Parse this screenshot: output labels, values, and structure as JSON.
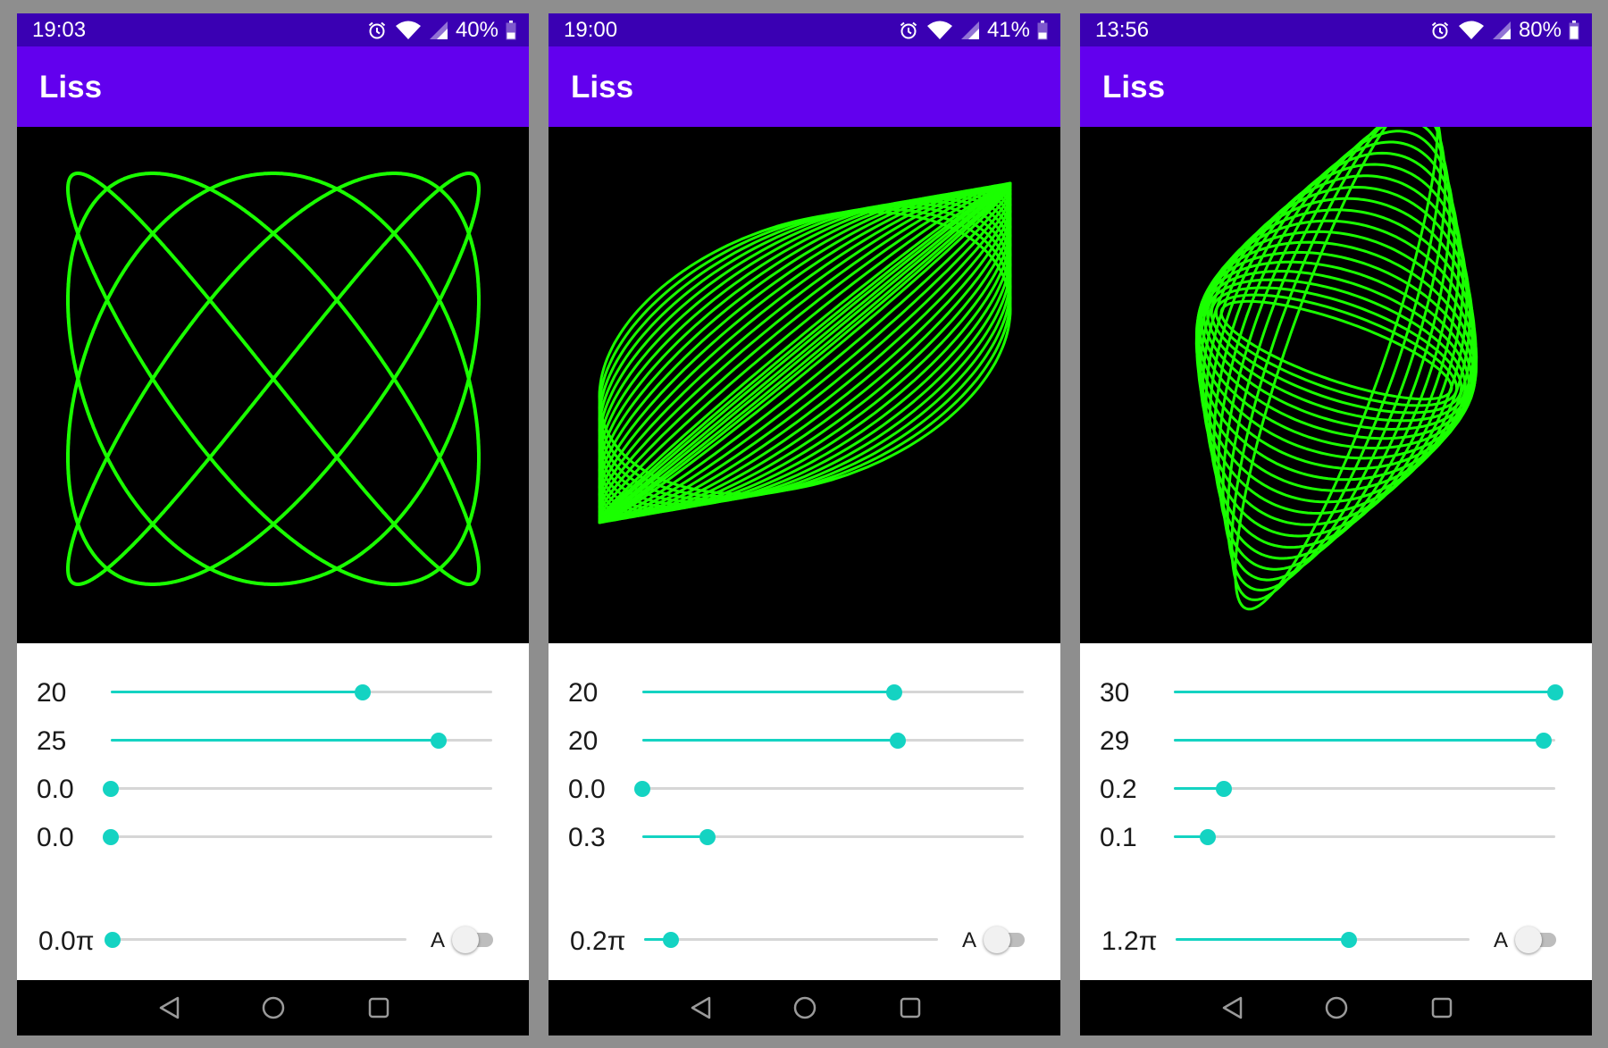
{
  "app_title": "Liss",
  "colors": {
    "status_bar": "#3a00b3",
    "app_bar": "#6200ee",
    "curve": "#1aff00",
    "accent": "#14d3c2"
  },
  "icons": {
    "status": [
      "alarm-icon",
      "wifi-icon",
      "signal-icon",
      "battery-icon"
    ],
    "nav": [
      "back-icon",
      "home-icon",
      "recents-icon"
    ]
  },
  "screens": [
    {
      "time": "19:03",
      "battery": "40%",
      "battery_level": 0.4,
      "sliders": [
        {
          "label": "20",
          "fraction": 0.66
        },
        {
          "label": "25",
          "fraction": 0.86
        },
        {
          "label": "0.0",
          "fraction": 0.0
        },
        {
          "label": "0.0",
          "fraction": 0.0
        }
      ],
      "phase": {
        "label": "0.0π",
        "fraction": 0.0
      },
      "auto_label": "A",
      "auto_on": false
    },
    {
      "time": "19:00",
      "battery": "41%",
      "battery_level": 0.41,
      "sliders": [
        {
          "label": "20",
          "fraction": 0.66
        },
        {
          "label": "20",
          "fraction": 0.67
        },
        {
          "label": "0.0",
          "fraction": 0.0
        },
        {
          "label": "0.3",
          "fraction": 0.17
        }
      ],
      "phase": {
        "label": "0.2π",
        "fraction": 0.09
      },
      "auto_label": "A",
      "auto_on": false
    },
    {
      "time": "13:56",
      "battery": "80%",
      "battery_level": 0.8,
      "sliders": [
        {
          "label": "30",
          "fraction": 1.0
        },
        {
          "label": "29",
          "fraction": 0.97
        },
        {
          "label": "0.2",
          "fraction": 0.13
        },
        {
          "label": "0.1",
          "fraction": 0.09
        }
      ],
      "phase": {
        "label": "1.2π",
        "fraction": 0.59
      },
      "auto_label": "A",
      "auto_on": false
    }
  ]
}
